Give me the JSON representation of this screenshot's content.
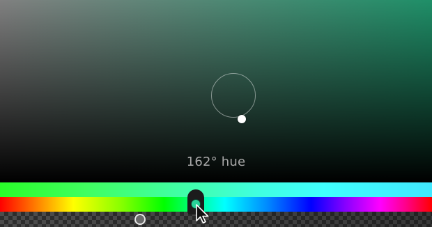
{
  "color_picker": {
    "hue_readout": "162° hue",
    "hue_degrees": 162,
    "current_color": "#29d39a",
    "field_base_color": "#1f8f68"
  },
  "icons": {
    "pointer": "arrow-cursor-icon"
  }
}
